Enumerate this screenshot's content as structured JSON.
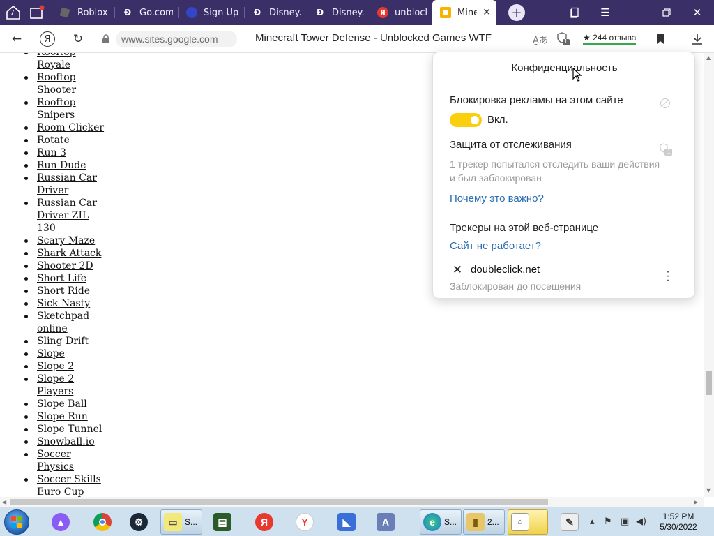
{
  "tabstrip": {
    "tab_count": "7",
    "tabs": [
      {
        "title": "Roblox",
        "icon": "roblox-favicon"
      },
      {
        "title": "Go.com",
        "icon": "disney-favicon"
      },
      {
        "title": "Sign Up",
        "icon": "signup-favicon"
      },
      {
        "title": "Disney.c",
        "icon": "disney-favicon"
      },
      {
        "title": "Disney.c",
        "icon": "disney-favicon"
      },
      {
        "title": "unblock",
        "icon": "yandex-favicon"
      },
      {
        "title": "Mine",
        "icon": "sites-favicon",
        "active": true
      }
    ],
    "new_tab": "+"
  },
  "addressbar": {
    "yandex_logo": "Я",
    "url": "www.sites.google.com",
    "title": "Minecraft Tower Defense - Unblocked Games WTF",
    "reviews": "★ 244 отзыва",
    "privacy_badge": "1"
  },
  "page": {
    "games": [
      "Rooftop Royale",
      "Rooftop Shooter",
      "Rooftop Snipers",
      "Room Clicker",
      "Rotate",
      "Run 3",
      "Run Dude",
      "Russian Car Driver",
      "Russian Car Driver ZIL 130",
      "Scary Maze",
      "Shark Attack",
      "Shooter 2D",
      "Short Life",
      "Short Ride",
      "Sick Nasty",
      "Sketchpad online",
      "Sling Drift",
      "Slope",
      "Slope 2",
      "Slope 2 Players",
      "Slope Ball",
      "Slope Run",
      "Slope Tunnel",
      "Snowball.io",
      "Soccer Physics",
      "Soccer Skills Euro Cup"
    ]
  },
  "privacy": {
    "title": "Конфиденциальность",
    "ad_block_title": "Блокировка рекламы на этом сайте",
    "ad_block_state": "Вкл.",
    "tracking_title": "Защита от отслеживания",
    "tracking_badge": "1",
    "tracking_desc_1": "1 трекер попытался отследить ваши действия",
    "tracking_desc_2": "и был заблокирован",
    "why_link": "Почему это важно?",
    "trackers_title": "Трекеры на этой веб-странице",
    "site_broken_link": "Сайт не работает?",
    "tracker_name": "doubleclick.net",
    "tracker_status": "Заблокирован до посещения"
  },
  "taskbar": {
    "items": [
      {
        "label": "S...",
        "icon": "sticky-notes-icon"
      },
      {
        "label": "S...",
        "icon": "edge-icon"
      },
      {
        "label": "2...",
        "icon": "folder-icon"
      }
    ],
    "clock_time": "1:52 PM",
    "clock_date": "5/30/2022"
  },
  "colors": {
    "tabstrip_bg": "#3a2f66",
    "toggle_on": "#f9cf10",
    "link": "#2a6bb0",
    "taskbar_bg": "#cfe0ee"
  }
}
